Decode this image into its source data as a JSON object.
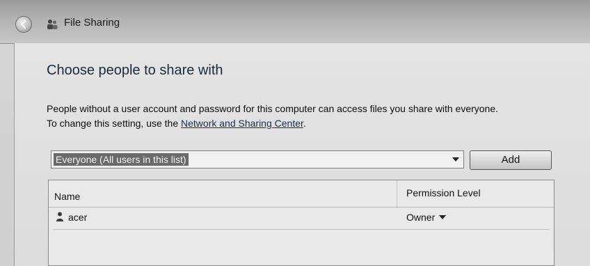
{
  "window": {
    "title": "File Sharing"
  },
  "main": {
    "heading": "Choose people to share with",
    "info_line1": "People without a user account and password for this computer can access files you share with everyone.",
    "info_line2_prefix": "To change this setting, use the ",
    "info_link": "Network and Sharing Center",
    "info_line2_suffix": "."
  },
  "user_select": {
    "selected": "Everyone (All users in this list)"
  },
  "add_button": {
    "label": "Add"
  },
  "share_list": {
    "headers": {
      "name": "Name",
      "permission": "Permission Level"
    },
    "rows": [
      {
        "name": "acer",
        "permission": "Owner"
      }
    ]
  },
  "icons": {
    "back": "back-arrow-icon",
    "title": "file-sharing-users-icon",
    "user": "user-icon",
    "dropdown": "chevron-down-icon"
  }
}
